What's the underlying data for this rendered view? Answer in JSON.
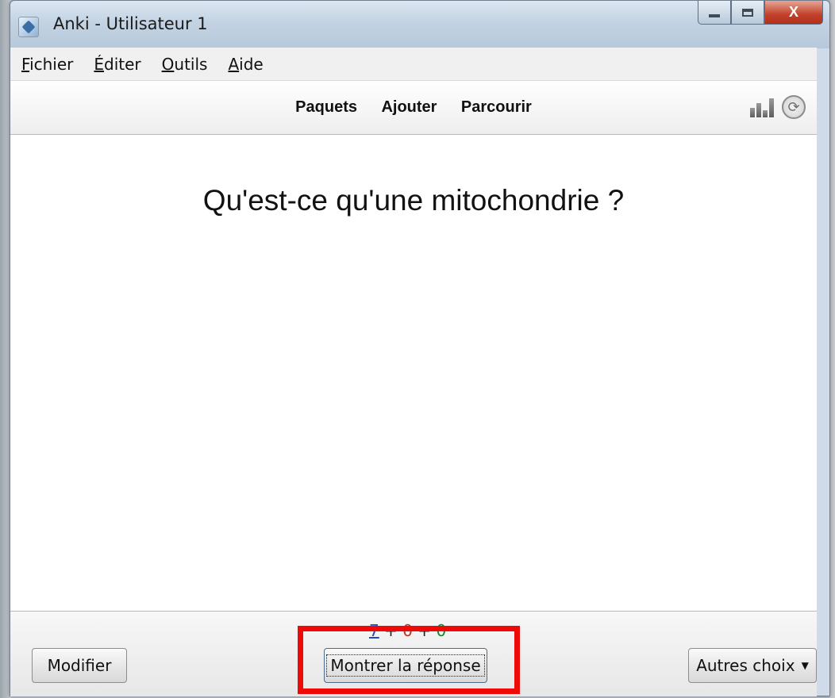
{
  "window": {
    "title": "Anki - Utilisateur 1",
    "close_label": "X"
  },
  "menubar": {
    "items": [
      {
        "first": "F",
        "rest": "ichier"
      },
      {
        "first": "É",
        "rest": "diter"
      },
      {
        "first": "O",
        "rest": "utils"
      },
      {
        "first": "A",
        "rest": "ide"
      }
    ]
  },
  "toolbar": {
    "links": [
      "Paquets",
      "Ajouter",
      "Parcourir"
    ],
    "icons": [
      "stats-icon",
      "sync-icon"
    ]
  },
  "card": {
    "question": "Qu'est-ce qu'une mitochondrie ?"
  },
  "bottombar": {
    "counts": {
      "new": "7",
      "sep1": " + ",
      "learn": "0",
      "sep2": " + ",
      "due": "0"
    },
    "edit_label": "Modifier",
    "show_answer_label": "Montrer la réponse",
    "more_label": "Autres choix",
    "more_caret": "▼"
  },
  "colors": {
    "highlight": "#ef0a0a",
    "count_new": "#1a49c7",
    "count_learn": "#c2311e",
    "count_due": "#0e8a2e"
  }
}
